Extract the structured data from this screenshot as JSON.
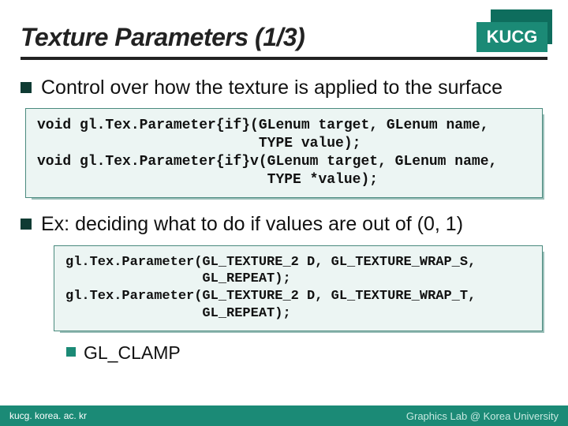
{
  "header": {
    "title": "Texture Parameters (1/3)",
    "logo": "KUCG"
  },
  "bullets": {
    "b1": "Control over how the texture is applied to the surface",
    "b2": "Ex: deciding what to do if values are out of (0, 1)",
    "b3": "GL_CLAMP"
  },
  "code": {
    "block1": "void gl.Tex.Parameter{if}(GLenum target, GLenum name,\n                          TYPE value);\nvoid gl.Tex.Parameter{if}v(GLenum target, GLenum name,\n                           TYPE *value);",
    "block2": "gl.Tex.Parameter(GL_TEXTURE_2 D, GL_TEXTURE_WRAP_S,\n                 GL_REPEAT);\ngl.Tex.Parameter(GL_TEXTURE_2 D, GL_TEXTURE_WRAP_T,\n                 GL_REPEAT);"
  },
  "footer": {
    "left": "kucg. korea. ac. kr",
    "right": "Graphics Lab @ Korea University"
  }
}
